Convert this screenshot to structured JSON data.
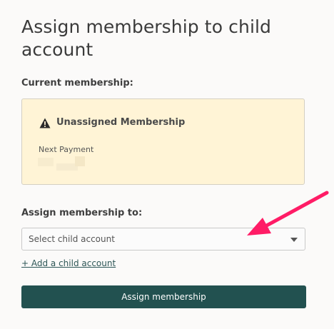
{
  "page": {
    "title": "Assign membership to child account"
  },
  "current_membership": {
    "label": "Current membership:",
    "icon": "warning-icon",
    "name": "Unassigned Membership",
    "next_payment_label": "Next Payment"
  },
  "assign": {
    "label": "Assign membership to:",
    "select_placeholder": "Select child account",
    "add_child_link": "+ Add a child account",
    "button_label": "Assign membership"
  },
  "colors": {
    "card_background": "#fff4d6",
    "button_background": "#225150",
    "arrow_annotation": "#ff1c66"
  }
}
